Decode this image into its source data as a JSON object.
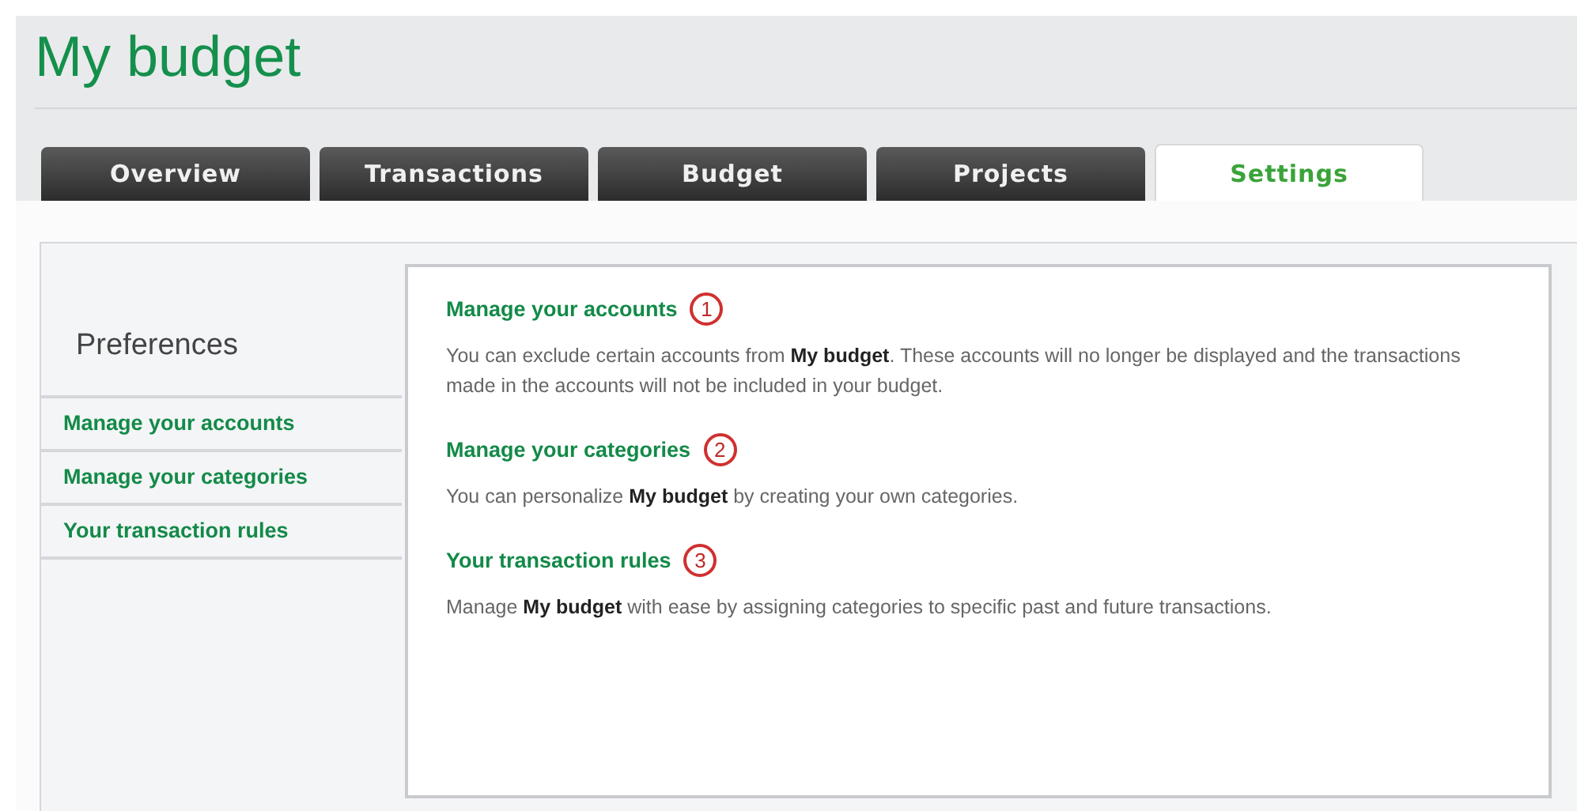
{
  "app_title": "My budget",
  "tabs": [
    {
      "label": "Overview",
      "selected": false
    },
    {
      "label": "Transactions",
      "selected": false
    },
    {
      "label": "Budget",
      "selected": false
    },
    {
      "label": "Projects",
      "selected": false
    },
    {
      "label": "Settings",
      "selected": true
    }
  ],
  "sidebar": {
    "heading": "Preferences",
    "items": [
      {
        "label": "Manage your accounts"
      },
      {
        "label": "Manage your categories"
      },
      {
        "label": "Your transaction rules"
      }
    ]
  },
  "sections": [
    {
      "title": "Manage your accounts",
      "callout": "1",
      "text": "You can exclude certain accounts from **My budget**. These accounts will no longer be displayed and the transactions made in  the accounts will not be included in your budget."
    },
    {
      "title": "Manage your categories",
      "callout": "2",
      "text": "You can personalize **My budget**  by creating your own categories."
    },
    {
      "title": "Your transaction rules",
      "callout": "3",
      "text": "Manage **My budget** with ease by assigning categories to specific past and future transactions."
    }
  ]
}
